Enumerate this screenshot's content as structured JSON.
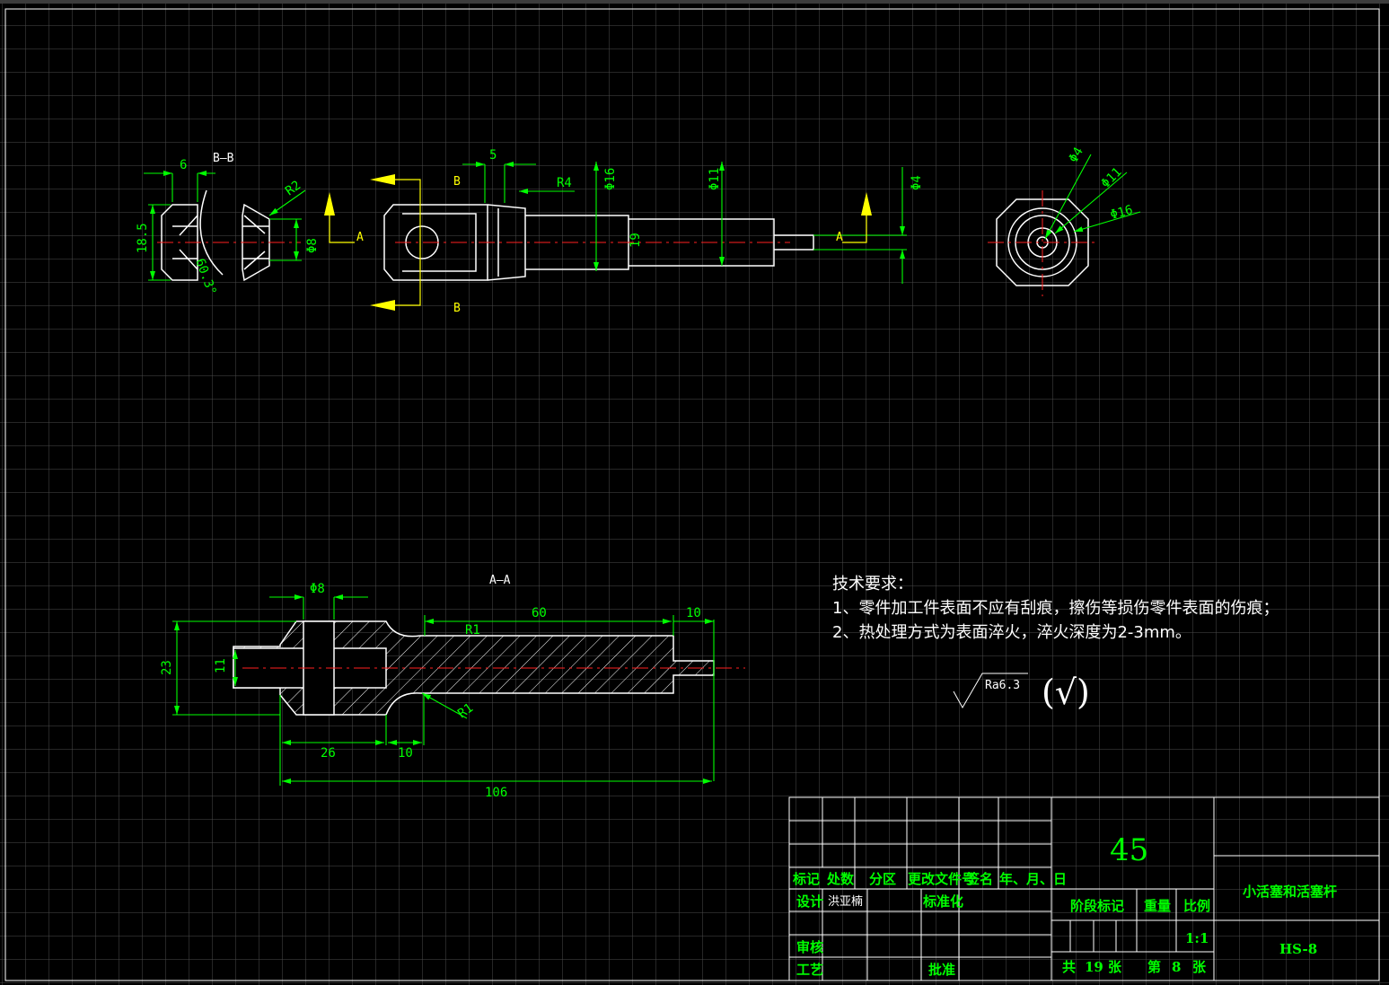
{
  "views": {
    "section_bb_label": "B—B",
    "section_aa_label": "A—A",
    "cut_a": "A",
    "cut_b": "B"
  },
  "dims": {
    "bb_6": "6",
    "bb_185": "18.5",
    "bb_r2": "R2",
    "bb_phi8": "Φ8",
    "bb_angle": "60.3°",
    "main_5": "5",
    "main_r4": "R4",
    "main_phi16": "Φ16",
    "main_phi11": "Φ11",
    "main_phi4": "Φ4",
    "main_19": "19",
    "end_phi4": "Φ4",
    "end_phi11": "Φ11",
    "end_phi16": "Φ16",
    "aa_phi8": "Φ8",
    "aa_60": "60",
    "aa_10a": "10",
    "aa_r1a": "R1",
    "aa_r1b": "R1",
    "aa_23": "23",
    "aa_11": "11",
    "aa_26": "26",
    "aa_10b": "10",
    "aa_106": "106"
  },
  "tech": {
    "title": "技术要求：",
    "line1": "1、零件加工件表面不应有刮痕，擦伤等损伤零件表面的伤痕；",
    "line2": "2、热处理方式为表面淬火，淬火深度为2-3mm。"
  },
  "roughness": {
    "value": "Ra6.3",
    "other": "(√)"
  },
  "title_block": {
    "material": "45",
    "part_name": "小活塞和活塞杆",
    "drawing_no": "HS-8",
    "h_mark": "标记",
    "h_count": "处数",
    "h_zone": "分区",
    "h_change": "更改文件号",
    "h_sign": "签名",
    "h_date": "年、月、日",
    "design": "设计",
    "designer": "洪亚楠",
    "standard": "标准化",
    "review": "审核",
    "process": "工艺",
    "approve": "批准",
    "stage": "阶段标记",
    "weight": "重量",
    "scale_label": "比例",
    "scale": "1:1",
    "total_pre": "共",
    "total": "19",
    "sheet_unit": "张",
    "no_pre": "第",
    "no": "8",
    "no_unit": "张"
  }
}
